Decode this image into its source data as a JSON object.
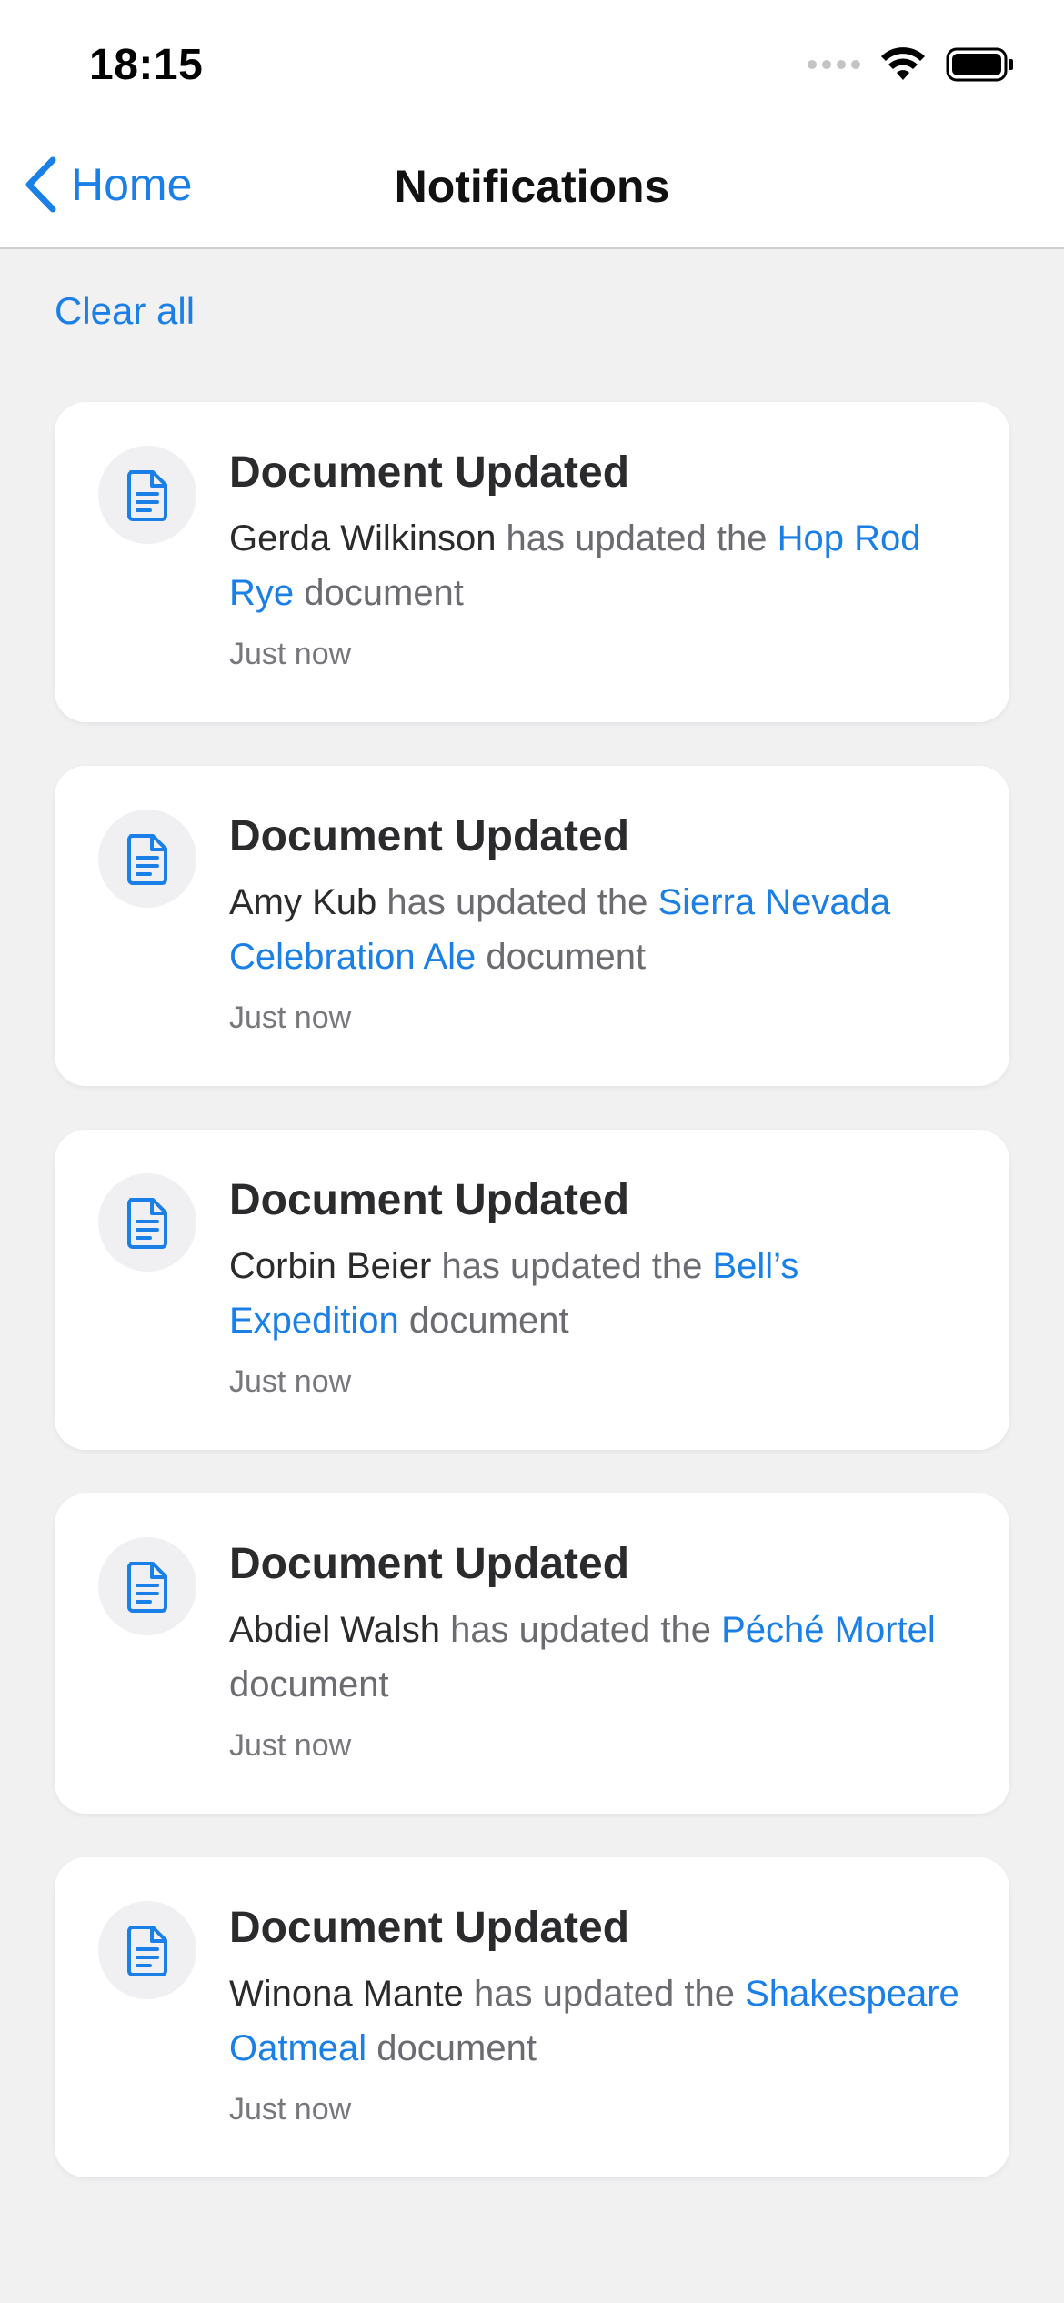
{
  "status_bar": {
    "time": "18:15"
  },
  "nav": {
    "back_label": "Home",
    "title": "Notifications"
  },
  "clear_all_label": "Clear all",
  "colors": {
    "accent": "#1a7fe6",
    "background": "#f1f1f2",
    "card": "#ffffff"
  },
  "notifications": [
    {
      "icon": "document-icon",
      "title": "Document Updated",
      "actor": "Gerda Wilkinson",
      "verb": " has updated the ",
      "document": "Hop Rod Rye",
      "suffix": " document",
      "time": "Just now"
    },
    {
      "icon": "document-icon",
      "title": "Document Updated",
      "actor": "Amy Kub",
      "verb": " has updated the ",
      "document": "Sierra Nevada Celebration Ale",
      "suffix": " document",
      "time": "Just now"
    },
    {
      "icon": "document-icon",
      "title": "Document Updated",
      "actor": "Corbin Beier",
      "verb": " has updated the ",
      "document": "Bell’s Expedition",
      "suffix": " document",
      "time": "Just now"
    },
    {
      "icon": "document-icon",
      "title": "Document Updated",
      "actor": "Abdiel Walsh",
      "verb": " has updated the ",
      "document": "Péché Mortel",
      "suffix": " document",
      "time": "Just now"
    },
    {
      "icon": "document-icon",
      "title": "Document Updated",
      "actor": "Winona Mante",
      "verb": " has updated the ",
      "document": "Shakespeare Oatmeal",
      "suffix": " document",
      "time": "Just now"
    }
  ]
}
